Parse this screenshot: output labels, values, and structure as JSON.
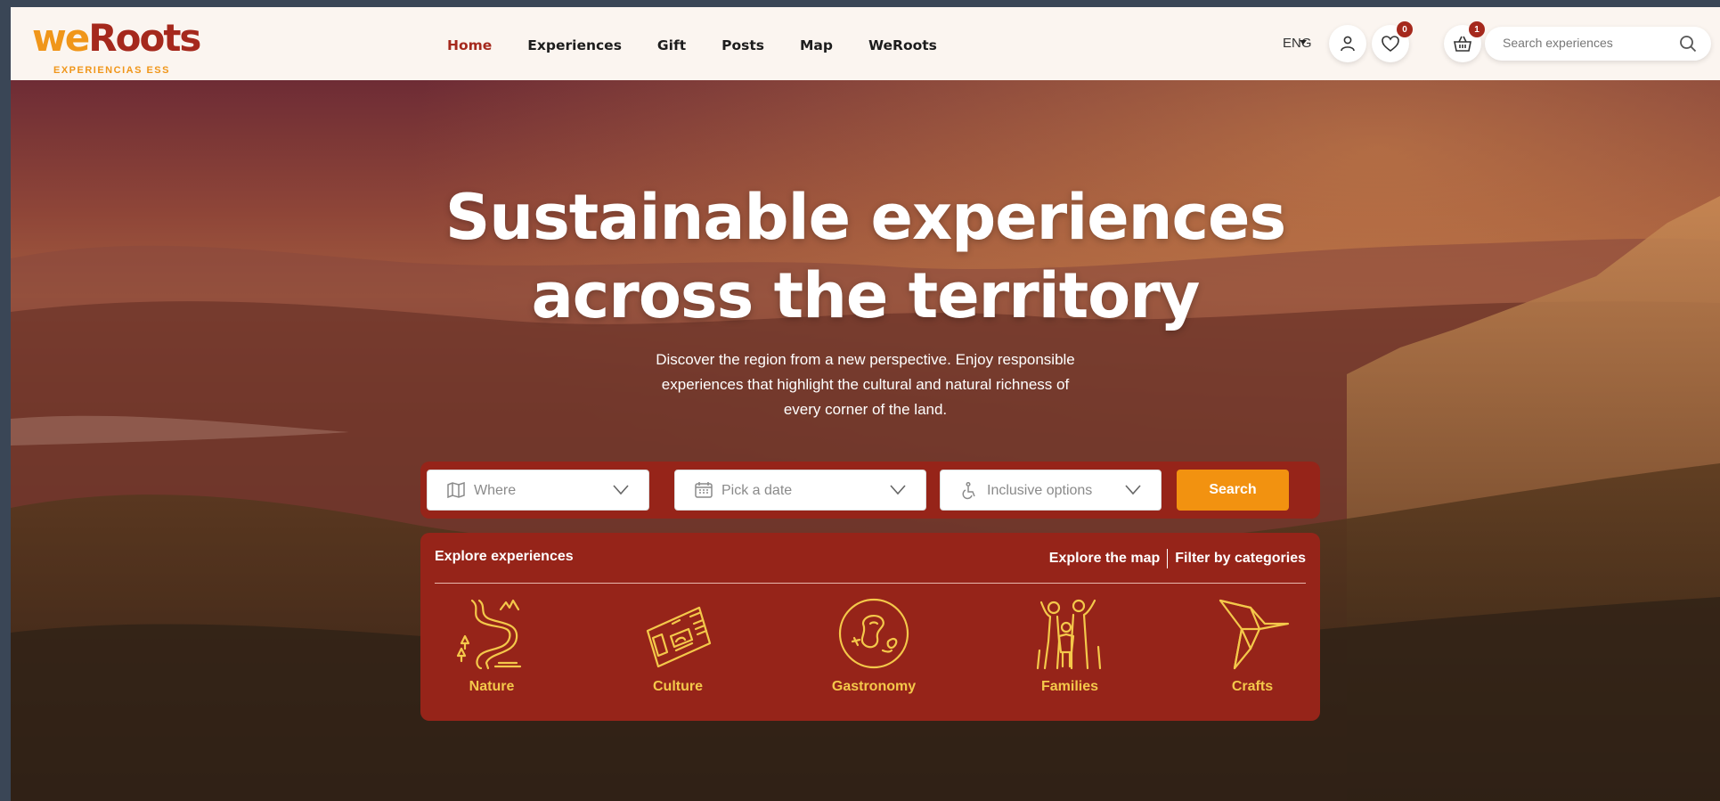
{
  "logo": {
    "brand_we": "we",
    "brand_roots": "Roots",
    "subtitle": "EXPERIENCIAS ESS"
  },
  "nav": {
    "items": [
      {
        "label": "Home",
        "active": true
      },
      {
        "label": "Experiences"
      },
      {
        "label": "Gift"
      },
      {
        "label": "Posts"
      },
      {
        "label": "Map"
      },
      {
        "label": "WeRoots"
      }
    ]
  },
  "header": {
    "language": "ENG",
    "favorites_count": "0",
    "cart_count": "1",
    "search_placeholder": "Search experiences"
  },
  "hero": {
    "title_line1": "Sustainable experiences",
    "title_line2": "across the territory",
    "subtitle_line1": "Discover the region from a new perspective. Enjoy responsible",
    "subtitle_line2": "experiences that highlight the cultural and natural richness of",
    "subtitle_line3": "every corner of the land."
  },
  "filters": {
    "where": "Where",
    "date": "Pick a date",
    "inclusive": "Inclusive options",
    "search_button": "Search"
  },
  "explore": {
    "title": "Explore experiences",
    "map_link": "Explore the map",
    "categories_link": "Filter by categories",
    "categories": [
      {
        "label": "Nature",
        "icon": "nature-icon"
      },
      {
        "label": "Culture",
        "icon": "culture-icon"
      },
      {
        "label": "Gastronomy",
        "icon": "gastronomy-icon"
      },
      {
        "label": "Families",
        "icon": "families-icon"
      },
      {
        "label": "Crafts",
        "icon": "crafts-icon"
      }
    ]
  },
  "colors": {
    "brand_red": "#a5291d",
    "brand_orange": "#f0961a",
    "panel_red": "#962419",
    "search_orange": "#f29210",
    "category_yellow": "#f4c84a"
  }
}
